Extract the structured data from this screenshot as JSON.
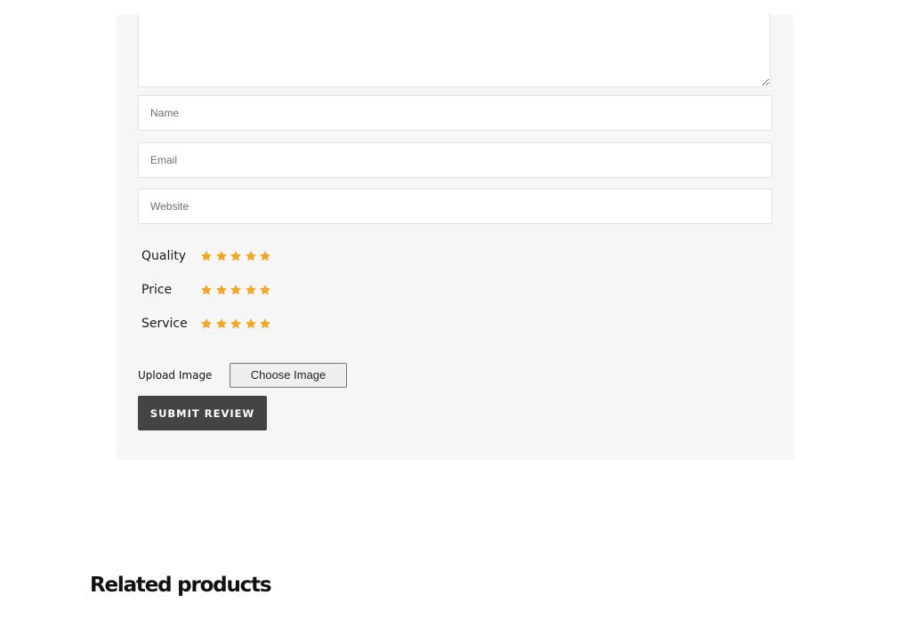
{
  "review_form": {
    "textarea_value": "",
    "name_placeholder": "Name",
    "email_placeholder": "Email",
    "website_placeholder": "Website",
    "ratings": [
      {
        "label": "Quality",
        "stars": 5
      },
      {
        "label": "Price",
        "stars": 5
      },
      {
        "label": "Service",
        "stars": 5
      }
    ],
    "upload_label": "Upload Image",
    "choose_button_label": "Choose Image",
    "submit_label": "Submit Review"
  },
  "related": {
    "title": "Related products"
  },
  "colors": {
    "panel_bg": "#f6f6f6",
    "star": "#f5a623",
    "submit_bg": "#444444",
    "border": "#e3e3e3"
  },
  "icons": {
    "star": "star-icon",
    "resize": "resize-grip-icon"
  }
}
